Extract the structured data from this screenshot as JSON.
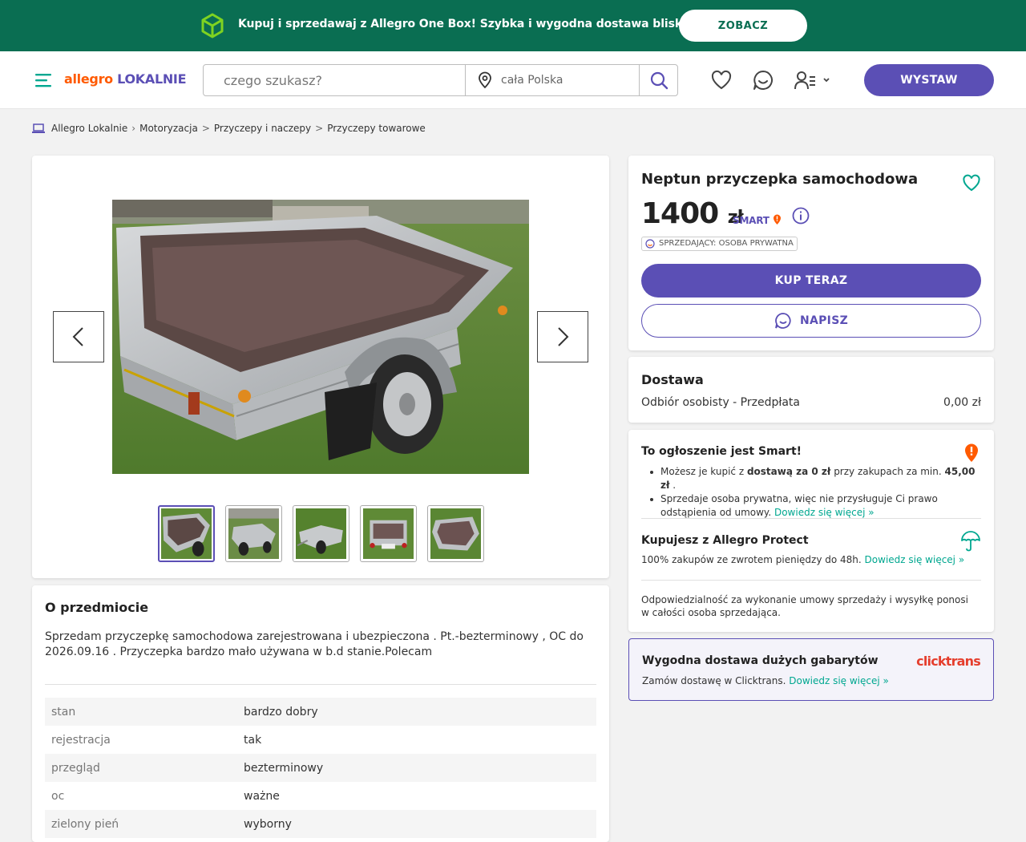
{
  "promo": {
    "text": "Kupuj i sprzedawaj z Allegro One Box! Szybka i wygodna dostawa blisko Ciebie",
    "button": "ZOBACZ",
    "color": "#0a6e52"
  },
  "header": {
    "logo_part1": "allegro",
    "logo_part2": "LOKALNIE",
    "search_placeholder": "czego szukasz?",
    "location": "cała Polska",
    "publish_button": "WYSTAW",
    "accent_color": "#5b4fb5"
  },
  "breadcrumb": [
    "Allegro Lokalnie",
    "Motoryzacja",
    "Przyczepy i naczepy",
    "Przyczepy towarowe"
  ],
  "gallery": {
    "thumbnail_count": 5,
    "active_index": 0
  },
  "offer": {
    "title": "Neptun przyczepka samochodowa",
    "price": "1400",
    "currency": "zł",
    "smart_label": "SMART",
    "seller_type": "SPRZEDAJĄCY: OSOBA PRYWATNA",
    "buy_button": "KUP TERAZ",
    "message_button": "NAPISZ"
  },
  "delivery": {
    "heading": "Dostawa",
    "method": "Odbiór osobisty - Przedpłata",
    "cost": "0,00 zł"
  },
  "smart": {
    "heading": "To ogłoszenie jest Smart!",
    "item1_a": "Możesz je kupić z",
    "item1_b": "dostawą za 0 zł",
    "item1_c": "przy zakupach za min.",
    "item1_d": "45,00 zł",
    "item1_e": ".",
    "item2": "Sprzedaje osoba prywatna, więc nie przysługuje Ci prawo odstąpienia od umowy.",
    "more_link": "Dowiedz się więcej »",
    "protect_heading": "Kupujesz z Allegro Protect",
    "protect_text": "100% zakupów ze zwrotem pieniędzy do 48h.",
    "responsibility": "Odpowiedzialność za wykonanie umowy sprzedaży i wysyłkę ponosi w całości osoba sprzedająca."
  },
  "clicktrans": {
    "heading": "Wygodna dostawa dużych gabarytów",
    "text": "Zamów dostawę w Clicktrans.",
    "link": "Dowiedz się więcej »",
    "logo": "clicktrans"
  },
  "about": {
    "heading": "O przedmiocie",
    "description": "Sprzedam przyczepkę samochodowa zarejestrowana i ubezpieczona . Pt.-bezterminowy , OC do 2026.09.16 . Przyczepka bardzo mało używana w b.d stanie.Polecam",
    "specs": [
      {
        "key": "stan",
        "value": "bardzo dobry"
      },
      {
        "key": "rejestracja",
        "value": "tak"
      },
      {
        "key": "przegląd",
        "value": "bezterminowy"
      },
      {
        "key": "oc",
        "value": "ważne"
      },
      {
        "key": "zielony pień",
        "value": "wyborny"
      }
    ]
  }
}
